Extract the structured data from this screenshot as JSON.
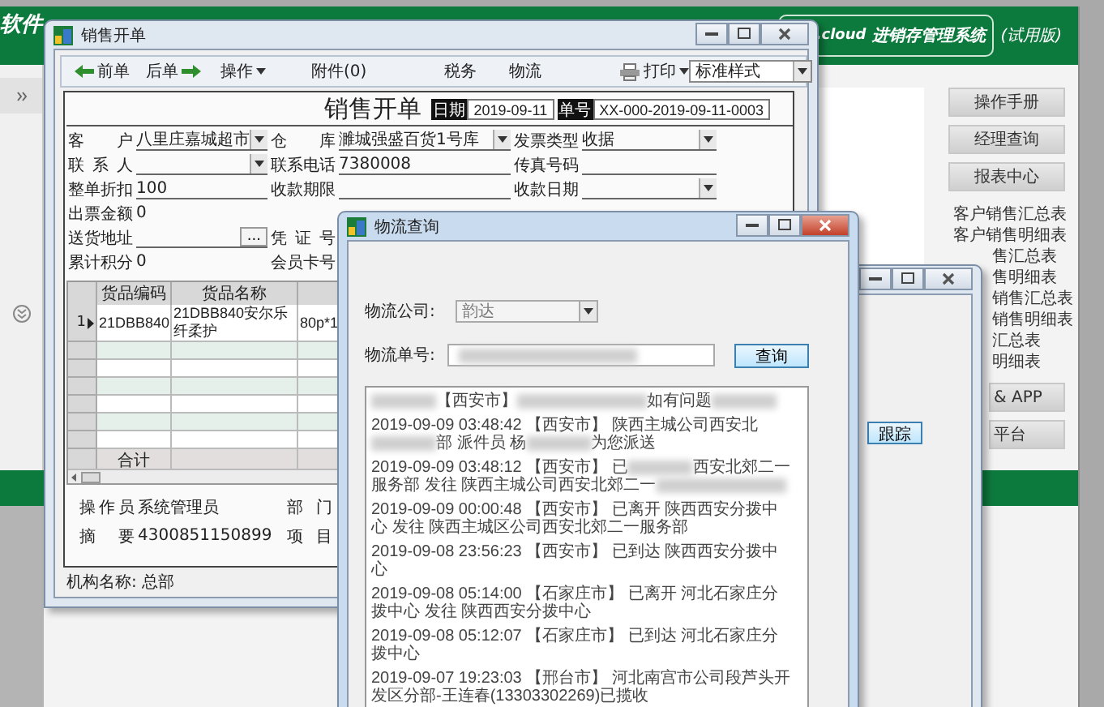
{
  "app": {
    "logo": "软件",
    "brand": ".cloud",
    "system": "进销存管理系统",
    "edition": "(试用版)",
    "side_buttons": [
      "操作手册",
      "经理查询",
      "报表中心"
    ],
    "report_links": [
      {
        "label": "客户销售汇总表",
        "kind": "full"
      },
      {
        "label": "客户销售明细表",
        "kind": "full"
      },
      {
        "label": "售汇总表",
        "kind": "partial"
      },
      {
        "label": "售明细表",
        "kind": "partial"
      },
      {
        "label": "销售汇总表",
        "kind": "partial"
      },
      {
        "label": "销售明细表",
        "kind": "partial"
      },
      {
        "label": "汇总表",
        "kind": "partial"
      },
      {
        "label": "明细表",
        "kind": "partial"
      }
    ],
    "lower_buttons": [
      "& APP",
      "平台"
    ]
  },
  "middle_window": {
    "track_button": "跟踪"
  },
  "sales_window": {
    "title": "销售开单",
    "toolbar": [
      {
        "kind": "prev",
        "label": "前单"
      },
      {
        "kind": "next",
        "label": "后单"
      },
      {
        "kind": "menu",
        "label": "操作"
      },
      {
        "kind": "plain",
        "label": "附件(0)"
      },
      {
        "kind": "plain",
        "label": "税务"
      },
      {
        "kind": "plain",
        "label": "物流"
      },
      {
        "kind": "print",
        "label": "打印"
      }
    ],
    "style_select": "标准样式",
    "heading": "销售开单",
    "date_label": "日期",
    "date": "2019-09-11",
    "number_label": "单号",
    "number": "XX-000-2019-09-11-0003",
    "field_rows": [
      [
        {
          "label": "客 户",
          "value": "八里庄嘉城超市",
          "kind": "select"
        },
        {
          "label": "仓 库",
          "value": "濉城强盛百货1号库",
          "kind": "select"
        },
        {
          "label": "发票类型",
          "value": "收据",
          "kind": "select"
        }
      ],
      [
        {
          "label": "联 系 人",
          "kind": "select"
        },
        {
          "label": "联系电话",
          "value": "7380008",
          "kind": "text"
        },
        {
          "label": "传真号码",
          "kind": "text"
        }
      ],
      [
        {
          "label": "整单折扣",
          "value": "100",
          "kind": "text"
        },
        {
          "label": "收款期限",
          "kind": "text"
        },
        {
          "label": "收款日期",
          "kind": "select"
        }
      ],
      [
        {
          "label": "出票金额",
          "value": "0",
          "kind": "plain"
        }
      ],
      [
        {
          "label": "送货地址",
          "kind": "browse",
          "button": "..."
        },
        {
          "label": "凭 证 号",
          "kind": "plain"
        }
      ],
      [
        {
          "label": "累计积分",
          "value": "0",
          "kind": "plain"
        },
        {
          "label": "会员卡号",
          "kind": "plain"
        }
      ]
    ],
    "grid": {
      "columns": [
        "货品编码",
        "货品名称"
      ],
      "rows": [
        {
          "number": "1",
          "current": true,
          "cells": [
            "21DBB840",
            "21DBB840安尔乐纤柔护",
            "80p*1"
          ]
        }
      ],
      "total_label": "合计"
    },
    "bottom_fields": [
      {
        "label": "操作员",
        "value": "系统管理员"
      },
      {
        "label": "部 门"
      },
      {
        "label": "摘 要",
        "value": "4300851150899"
      },
      {
        "label": "项 目"
      }
    ],
    "org_label": "机构名称:",
    "org": "总部"
  },
  "logistics_dialog": {
    "title": "物流查询",
    "company_label": "物流公司:",
    "company": "韵达",
    "company_disabled": true,
    "number_label": "物流单号:",
    "number_blurred": true,
    "query_button": "查询",
    "entries": [
      {
        "segments": [
          {
            "kind": "blur-short"
          },
          {
            "kind": "text",
            "text": "【西安市】"
          },
          {
            "kind": "blur-long"
          },
          {
            "kind": "text",
            "text": "如有问题"
          },
          {
            "kind": "blur-short"
          }
        ]
      },
      {
        "time": "2019-09-09 03:48:42",
        "segments": [
          {
            "kind": "text",
            "text": "【西安市】 陕西主城公司西安北"
          },
          {
            "kind": "blur-short"
          },
          {
            "kind": "text",
            "text": "部 派件员 杨"
          },
          {
            "kind": "blur-short"
          },
          {
            "kind": "text",
            "text": "为您派送"
          }
        ]
      },
      {
        "time": "2019-09-09 03:48:12",
        "segments": [
          {
            "kind": "text",
            "text": "【西安市】 已"
          },
          {
            "kind": "blur-short"
          },
          {
            "kind": "text",
            "text": "西安北郊二一服务部 发往 陕西主城公司西安北郊二一"
          },
          {
            "kind": "blur-long"
          }
        ]
      },
      {
        "time": "2019-09-09 00:00:48",
        "segments": [
          {
            "kind": "text",
            "text": "【西安市】 已离开 陕西西安分拨中心 发往 陕西主城区公司西安北郊二一服务部"
          }
        ]
      },
      {
        "time": "2019-09-08 23:56:23",
        "segments": [
          {
            "kind": "text",
            "text": "【西安市】 已到达 陕西西安分拨中心"
          }
        ]
      },
      {
        "time": "2019-09-08 05:14:00",
        "segments": [
          {
            "kind": "text",
            "text": "【石家庄市】 已离开 河北石家庄分拨中心 发往 陕西西安分拨中心"
          }
        ]
      },
      {
        "time": "2019-09-08 05:12:07",
        "segments": [
          {
            "kind": "text",
            "text": "【石家庄市】 已到达 河北石家庄分拨中心"
          }
        ]
      },
      {
        "time": "2019-09-07 19:23:03",
        "segments": [
          {
            "kind": "text",
            "text": "【邢台市】 河北南宫市公司段芦头开发区分部-王连春(13303302269)已揽收"
          }
        ]
      }
    ]
  }
}
